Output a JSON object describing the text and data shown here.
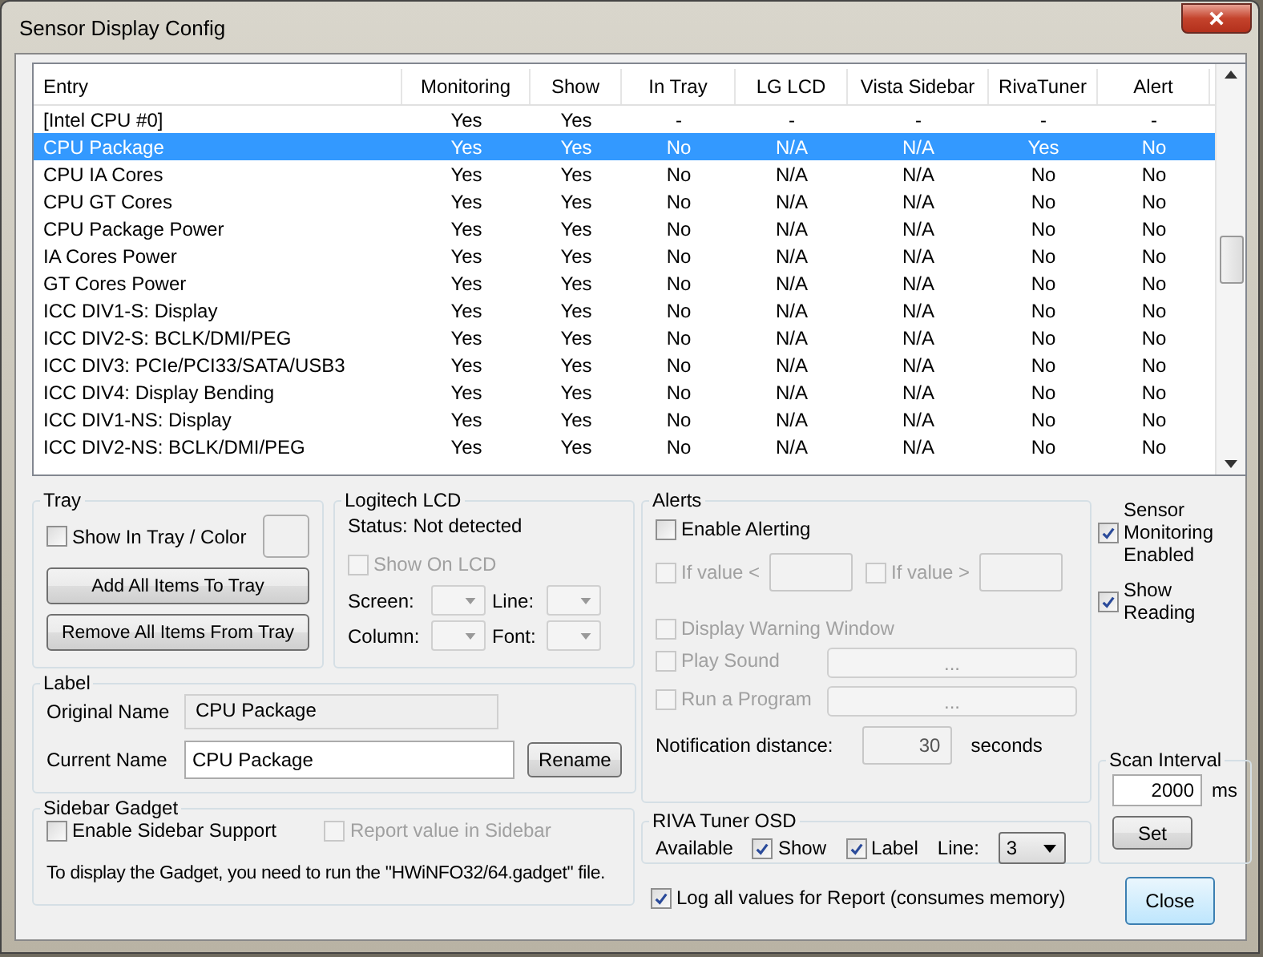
{
  "window": {
    "title": "Sensor Display Config"
  },
  "table": {
    "columns": [
      "Entry",
      "Monitoring",
      "Show",
      "In Tray",
      "LG LCD",
      "Vista Sidebar",
      "RivaTuner",
      "Alert"
    ],
    "rows": [
      {
        "cells": [
          "[Intel CPU #0]",
          "Yes",
          "Yes",
          "-",
          "-",
          "-",
          "-",
          "-"
        ],
        "selected": false
      },
      {
        "cells": [
          "CPU Package",
          "Yes",
          "Yes",
          "No",
          "N/A",
          "N/A",
          "Yes",
          "No"
        ],
        "selected": true
      },
      {
        "cells": [
          "CPU IA Cores",
          "Yes",
          "Yes",
          "No",
          "N/A",
          "N/A",
          "No",
          "No"
        ],
        "selected": false
      },
      {
        "cells": [
          "CPU GT Cores",
          "Yes",
          "Yes",
          "No",
          "N/A",
          "N/A",
          "No",
          "No"
        ],
        "selected": false
      },
      {
        "cells": [
          "CPU Package Power",
          "Yes",
          "Yes",
          "No",
          "N/A",
          "N/A",
          "No",
          "No"
        ],
        "selected": false
      },
      {
        "cells": [
          "IA Cores Power",
          "Yes",
          "Yes",
          "No",
          "N/A",
          "N/A",
          "No",
          "No"
        ],
        "selected": false
      },
      {
        "cells": [
          "GT Cores Power",
          "Yes",
          "Yes",
          "No",
          "N/A",
          "N/A",
          "No",
          "No"
        ],
        "selected": false
      },
      {
        "cells": [
          "ICC DIV1-S: Display",
          "Yes",
          "Yes",
          "No",
          "N/A",
          "N/A",
          "No",
          "No"
        ],
        "selected": false
      },
      {
        "cells": [
          "ICC DIV2-S: BCLK/DMI/PEG",
          "Yes",
          "Yes",
          "No",
          "N/A",
          "N/A",
          "No",
          "No"
        ],
        "selected": false
      },
      {
        "cells": [
          "ICC DIV3: PCIe/PCI33/SATA/USB3",
          "Yes",
          "Yes",
          "No",
          "N/A",
          "N/A",
          "No",
          "No"
        ],
        "selected": false
      },
      {
        "cells": [
          "ICC DIV4: Display Bending",
          "Yes",
          "Yes",
          "No",
          "N/A",
          "N/A",
          "No",
          "No"
        ],
        "selected": false
      },
      {
        "cells": [
          "ICC DIV1-NS: Display",
          "Yes",
          "Yes",
          "No",
          "N/A",
          "N/A",
          "No",
          "No"
        ],
        "selected": false
      },
      {
        "cells": [
          "ICC DIV2-NS: BCLK/DMI/PEG",
          "Yes",
          "Yes",
          "No",
          "N/A",
          "N/A",
          "No",
          "No"
        ],
        "selected": false
      }
    ]
  },
  "tray": {
    "title": "Tray",
    "show_in_tray": {
      "label": "Show In Tray / Color",
      "checked": false
    },
    "buttons": [
      "Add All Items To Tray",
      "Remove All Items From Tray"
    ]
  },
  "logitech_lcd": {
    "title": "Logitech LCD",
    "status": "Status: Not detected",
    "show_on_lcd": {
      "label": "Show On LCD",
      "checked": false,
      "disabled": true
    },
    "fields": [
      "Screen:",
      "Line:",
      "Column:",
      "Font:"
    ]
  },
  "alerts": {
    "title": "Alerts",
    "enable": {
      "label": "Enable Alerting",
      "checked": false
    },
    "conditions": [
      {
        "label": "If value <",
        "checked": false,
        "disabled": true
      },
      {
        "label": "If value >",
        "checked": false,
        "disabled": true
      }
    ],
    "display_warning": {
      "label": "Display Warning Window",
      "checked": false,
      "disabled": true
    },
    "actions": [
      {
        "label": "Play Sound",
        "checked": false,
        "disabled": true,
        "button": "..."
      },
      {
        "label": "Run a Program",
        "checked": false,
        "disabled": true,
        "button": "..."
      }
    ],
    "notification": {
      "label": "Notification distance:",
      "value": "30",
      "unit": "seconds"
    }
  },
  "monitoring": [
    {
      "label": "Sensor Monitoring Enabled",
      "checked": true
    },
    {
      "label": "Show Reading",
      "checked": true
    }
  ],
  "scan_interval": {
    "title": "Scan Interval",
    "value": "2000",
    "unit": "ms",
    "button": "Set"
  },
  "label": {
    "title": "Label",
    "original_name_label": "Original Name",
    "original_name": "CPU Package",
    "current_name_label": "Current Name",
    "current_name": "CPU Package",
    "button": "Rename"
  },
  "sidebar_gadget": {
    "title": "Sidebar Gadget",
    "options": [
      {
        "label": "Enable Sidebar Support",
        "checked": false,
        "disabled": false
      },
      {
        "label": "Report value in Sidebar",
        "checked": false,
        "disabled": true
      }
    ],
    "note": "To display the Gadget, you need to run the \"HWiNFO32/64.gadget\" file."
  },
  "riva_tuner_osd": {
    "title": "RIVA Tuner OSD",
    "status": "Available",
    "options": [
      {
        "label": "Show",
        "checked": true
      },
      {
        "label": "Label",
        "checked": true
      }
    ],
    "line_label": "Line:",
    "line_value": "3"
  },
  "log": {
    "label": "Log all values for Report (consumes memory)",
    "checked": true
  },
  "close_button": "Close"
}
